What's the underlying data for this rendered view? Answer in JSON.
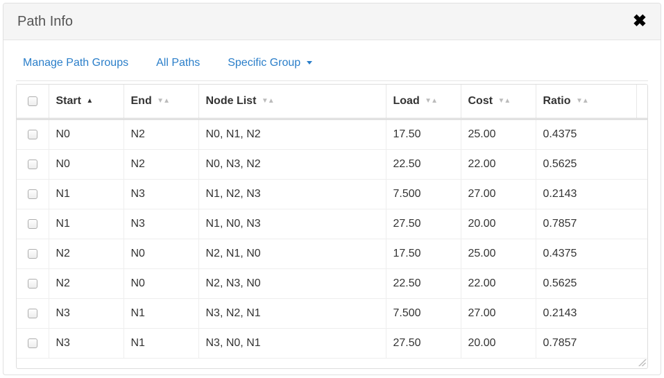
{
  "header": {
    "title": "Path Info"
  },
  "toolbar": {
    "manage_label": "Manage Path Groups",
    "allpaths_label": "All Paths",
    "specific_label": "Specific Group"
  },
  "table": {
    "columns": {
      "start": "Start",
      "end": "End",
      "nodelist": "Node List",
      "load": "Load",
      "cost": "Cost",
      "ratio": "Ratio"
    },
    "rows": [
      {
        "start": "N0",
        "end": "N2",
        "nodelist": "N0, N1, N2",
        "load": "17.50",
        "cost": "25.00",
        "ratio": "0.4375"
      },
      {
        "start": "N0",
        "end": "N2",
        "nodelist": "N0, N3, N2",
        "load": "22.50",
        "cost": "22.00",
        "ratio": "0.5625"
      },
      {
        "start": "N1",
        "end": "N3",
        "nodelist": "N1, N2, N3",
        "load": "7.500",
        "cost": "27.00",
        "ratio": "0.2143"
      },
      {
        "start": "N1",
        "end": "N3",
        "nodelist": "N1, N0, N3",
        "load": "27.50",
        "cost": "20.00",
        "ratio": "0.7857"
      },
      {
        "start": "N2",
        "end": "N0",
        "nodelist": "N2, N1, N0",
        "load": "17.50",
        "cost": "25.00",
        "ratio": "0.4375"
      },
      {
        "start": "N2",
        "end": "N0",
        "nodelist": "N2, N3, N0",
        "load": "22.50",
        "cost": "22.00",
        "ratio": "0.5625"
      },
      {
        "start": "N3",
        "end": "N1",
        "nodelist": "N3, N2, N1",
        "load": "7.500",
        "cost": "27.00",
        "ratio": "0.2143"
      },
      {
        "start": "N3",
        "end": "N1",
        "nodelist": "N3, N0, N1",
        "load": "27.50",
        "cost": "20.00",
        "ratio": "0.7857"
      }
    ]
  }
}
